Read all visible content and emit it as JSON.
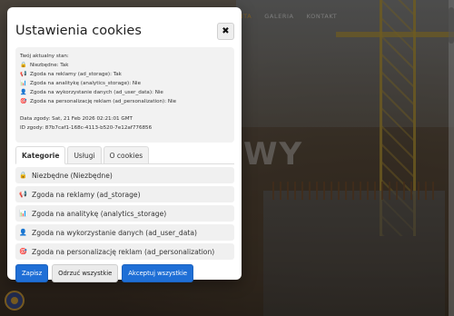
{
  "background": {
    "nav": [
      "ENTA",
      "GALERIA",
      "KONTAKT"
    ],
    "hero_text": "WY"
  },
  "modal": {
    "title": "Ustawienia cookies",
    "close_label": "✖",
    "status": {
      "heading": "Twój aktualny stan:",
      "lines": [
        {
          "icon": "lock-icon",
          "glyph": "🔒",
          "text": "Niezbędne: Tak"
        },
        {
          "icon": "megaphone-icon",
          "glyph": "📢",
          "text": "Zgoda na reklamy (ad_storage): Tak"
        },
        {
          "icon": "chart-icon",
          "glyph": "📊",
          "text": "Zgoda na analitykę (analytics_storage): Nie"
        },
        {
          "icon": "user-icon",
          "glyph": "👤",
          "text": "Zgoda na wykorzystanie danych (ad_user_data): Nie"
        },
        {
          "icon": "target-icon",
          "glyph": "🎯",
          "text": "Zgoda na personalizację reklam (ad_personalization): Nie"
        }
      ],
      "date": "Data zgody: Sat, 21 Feb 2026 02:21:01 GMT",
      "id": "ID zgody: 87b7caf1-168c-4113-b520-7e12af776856"
    },
    "tabs": [
      "Kategorie",
      "Usługi",
      "O cookies"
    ],
    "categories": [
      {
        "icon": "lock-icon",
        "glyph": "🔒",
        "label": "Niezbędne (Niezbędne)"
      },
      {
        "icon": "megaphone-icon",
        "glyph": "📢",
        "label": "Zgoda na reklamy (ad_storage)"
      },
      {
        "icon": "chart-icon",
        "glyph": "📊",
        "label": "Zgoda na analitykę (analytics_storage)"
      },
      {
        "icon": "user-icon",
        "glyph": "👤",
        "label": "Zgoda na wykorzystanie danych (ad_user_data)"
      },
      {
        "icon": "target-icon",
        "glyph": "🎯",
        "label": "Zgoda na personalizację reklam (ad_personalization)"
      }
    ],
    "buttons": {
      "save": "Zapisz",
      "reject": "Odrzuć wszystkie",
      "accept": "Akceptuj wszystkie"
    }
  },
  "colors": {
    "primary": "#1f6fd6",
    "nav_active": "#ffb733"
  }
}
